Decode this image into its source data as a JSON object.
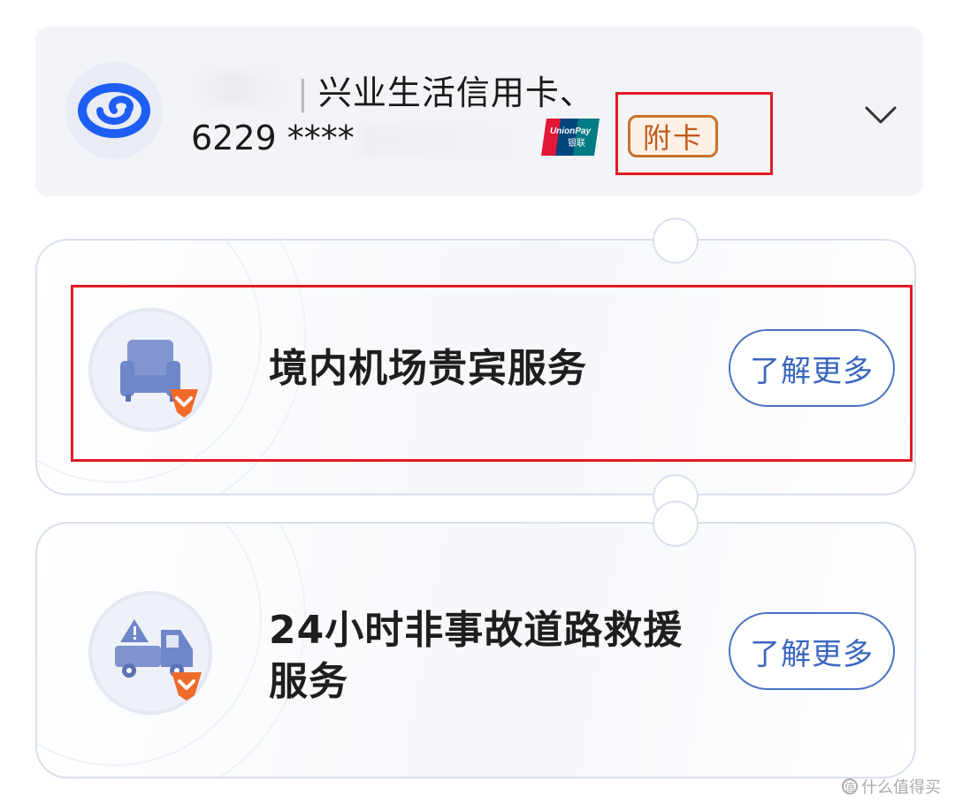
{
  "account_card": {
    "card_name": "兴业生活信用卡、",
    "card_number": "6229 ****",
    "network_logo_text": [
      "UnionPay",
      "银联"
    ],
    "sub_card_badge": "附卡",
    "icons": {
      "bank_logo": "bank-logo-icon",
      "network_logo": "unionpay-logo-icon",
      "expand": "chevron-down-icon"
    },
    "colors": {
      "bank_blue": "#1e5ef5",
      "badge_orange": "#c25a1c",
      "highlight_red": "#e31b23"
    }
  },
  "benefits": [
    {
      "title": "境内机场贵宾服务",
      "button_label": "了解更多",
      "icon": "armchair-icon"
    },
    {
      "title": "24小时非事故道路救援服务",
      "button_label": "了解更多",
      "icon": "tow-truck-icon"
    }
  ],
  "watermark": {
    "glyph": "值",
    "text": "什么值得买"
  },
  "colors": {
    "button_blue": "#3a66c0",
    "icon_blue": "#6f86c8",
    "accent_orange": "#f06a2a"
  }
}
